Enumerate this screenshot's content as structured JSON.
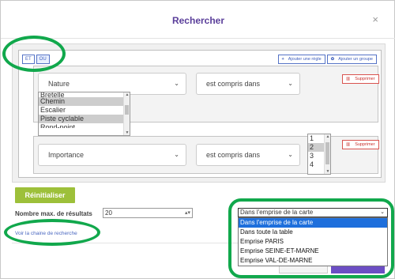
{
  "dialog": {
    "title": "Rechercher",
    "close_icon": "×"
  },
  "group": {
    "and_label": "ET",
    "or_label": "OU",
    "add_rule_label": "Ajouter une règle",
    "add_group_label": "Ajouter un groupe",
    "add_rule_icon": "+",
    "add_group_icon": "✿"
  },
  "rule1": {
    "field": "Nature",
    "operator": "est compris dans",
    "delete_label": "Supprimer",
    "delete_icon": "▥",
    "values": [
      "Bretelle",
      "Chemin",
      "Escalier",
      "Piste cyclable",
      "Rond-point"
    ],
    "selected": [
      "Chemin",
      "Piste cyclable"
    ]
  },
  "rule2": {
    "field": "Importance",
    "operator": "est compris dans",
    "delete_label": "Supprimer",
    "delete_icon": "▥",
    "values": [
      "1",
      "2",
      "3",
      "4"
    ],
    "selected": [
      "2"
    ]
  },
  "caret_icon": "⌄",
  "reset_label": "Réinitialiser",
  "max_results": {
    "label": "Nombre max. de résultats",
    "value": "20"
  },
  "search_chain_link": "Voir la chaine de recherche",
  "extent": {
    "selected": "Dans l'emprise de la carte",
    "options": [
      "Dans l'emprise de la carte",
      "Dans toute la table",
      "Emprise PARIS",
      "Emprise SEINE-ET-MARNE",
      "Emprise VAL-DE-MARNE"
    ]
  },
  "colors": {
    "title": "#5a3e9a",
    "reset_button": "#9dc03a",
    "annotation": "#11a84c",
    "highlight": "#1e6fdc"
  }
}
